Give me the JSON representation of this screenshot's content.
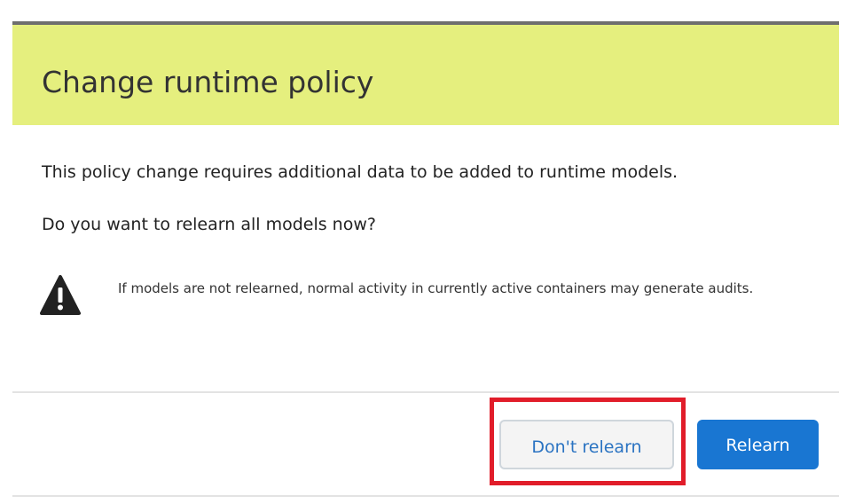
{
  "dialog": {
    "title": "Change runtime policy",
    "message_line1": "This policy change requires additional data to be added to runtime models.",
    "message_line2": "Do you want to relearn all models now?",
    "warning": {
      "icon": "warning-triangle-icon",
      "text": "If models are not relearned, normal activity in currently active containers may generate audits."
    },
    "buttons": {
      "dont_relearn_label": "Don't relearn",
      "relearn_label": "Relearn"
    }
  },
  "colors": {
    "header_background": "#e5ef7e",
    "primary_button": "#1976d2",
    "secondary_button_text": "#2a73c2",
    "highlight_outline": "#e11d2a"
  }
}
